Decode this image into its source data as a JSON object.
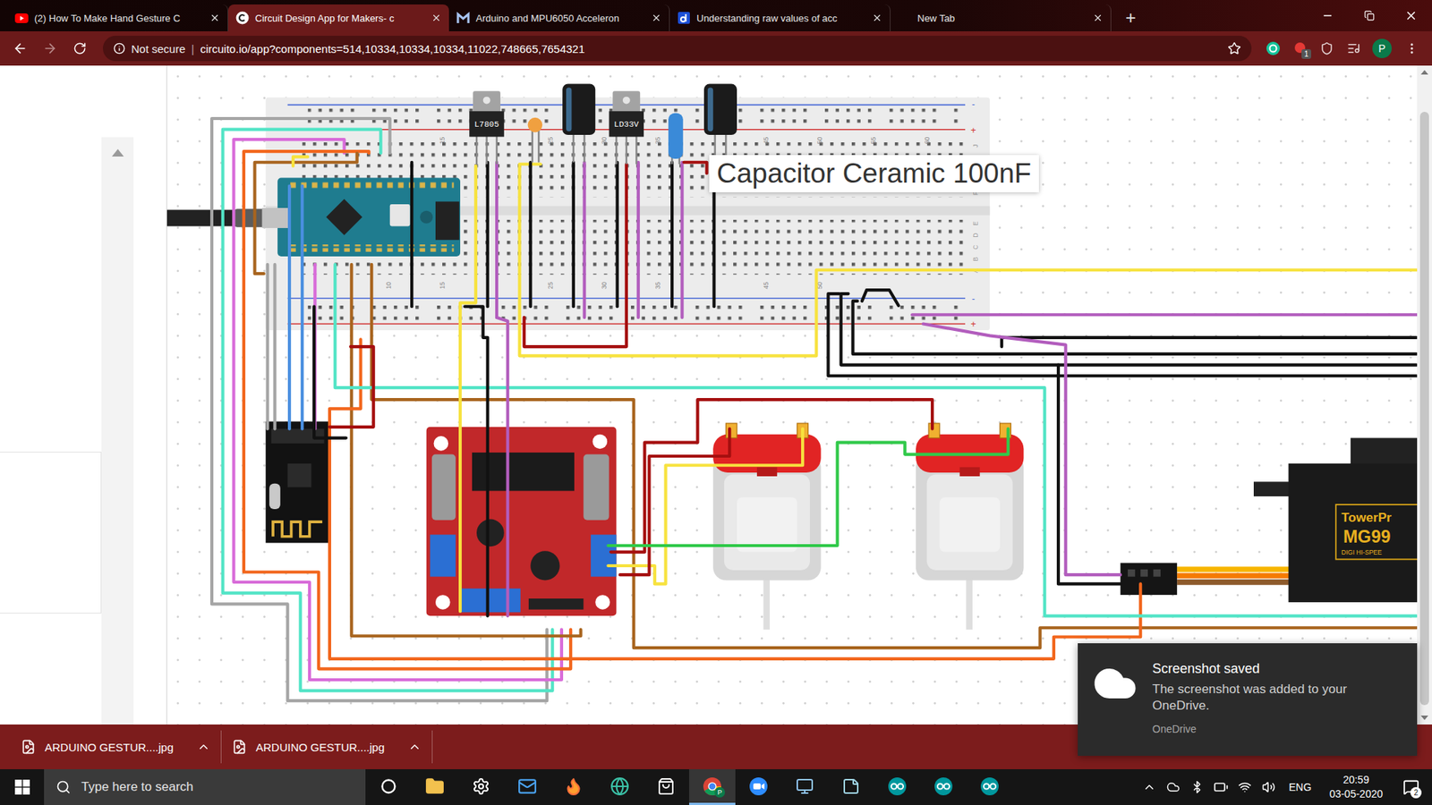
{
  "browser": {
    "tabs": [
      {
        "label": "(2) How To Make Hand Gesture C",
        "selected": false,
        "kind": "youtube"
      },
      {
        "label": "Circuit Design App for Makers- c",
        "selected": true,
        "kind": "circuito"
      },
      {
        "label": "Arduino and MPU6050 Acceleron",
        "selected": false,
        "kind": "gmail"
      },
      {
        "label": "Understanding raw values of acc",
        "selected": false,
        "kind": "doc"
      },
      {
        "label": "New Tab",
        "selected": false,
        "kind": "none"
      }
    ],
    "new_tab": "+",
    "address": {
      "security": "Not secure",
      "separator": "|",
      "url": "circuito.io/app?components=514,10334,10334,10334,11022,748665,7654321"
    },
    "extension_badge": "1",
    "profile": "P"
  },
  "canvas": {
    "tooltip": "Capacitor Ceramic 100nF",
    "breadboard": {
      "top_numbers": [
        "15",
        "25",
        "30",
        "35",
        "45",
        "50",
        "55",
        "60"
      ],
      "bottom_numbers": [
        "10",
        "15",
        "25",
        "30",
        "35",
        "45",
        "50"
      ],
      "top_letters": [
        "J",
        "I",
        "H",
        "G",
        "F"
      ],
      "bottom_letters": [
        "E",
        "D",
        "C",
        "B",
        "A"
      ],
      "rail_signs": [
        "-",
        "+"
      ]
    },
    "regulators": [
      {
        "label": "L7805"
      },
      {
        "label": "LD33V"
      }
    ],
    "servo": {
      "brand": "TowerPr",
      "model": "MG99",
      "subtitle": "DIGI HI-SPEE"
    }
  },
  "downloads": [
    {
      "name": "ARDUINO GESTUR....jpg"
    },
    {
      "name": "ARDUINO GESTUR....jpg"
    }
  ],
  "toast": {
    "title": "Screenshot saved",
    "body": "The screenshot was added to your OneDrive.",
    "source": "OneDrive"
  },
  "taskbar": {
    "search": "Type here to search",
    "apps": [
      {
        "kind": "cortana",
        "active": false
      },
      {
        "kind": "explorer",
        "active": false
      },
      {
        "kind": "settings",
        "active": false
      },
      {
        "kind": "mail",
        "active": false
      },
      {
        "kind": "firefox",
        "active": false
      },
      {
        "kind": "edge",
        "active": false
      },
      {
        "kind": "store",
        "active": false
      },
      {
        "kind": "chrome",
        "active": true,
        "badge": "P"
      },
      {
        "kind": "zoom",
        "active": false
      },
      {
        "kind": "desktop",
        "active": false
      },
      {
        "kind": "notes",
        "active": false
      },
      {
        "kind": "arduino",
        "active": false
      },
      {
        "kind": "arduino",
        "active": false
      },
      {
        "kind": "arduino",
        "active": false
      }
    ],
    "language": "ENG",
    "time": "20:59",
    "date": "03-05-2020",
    "notifications": "2"
  }
}
